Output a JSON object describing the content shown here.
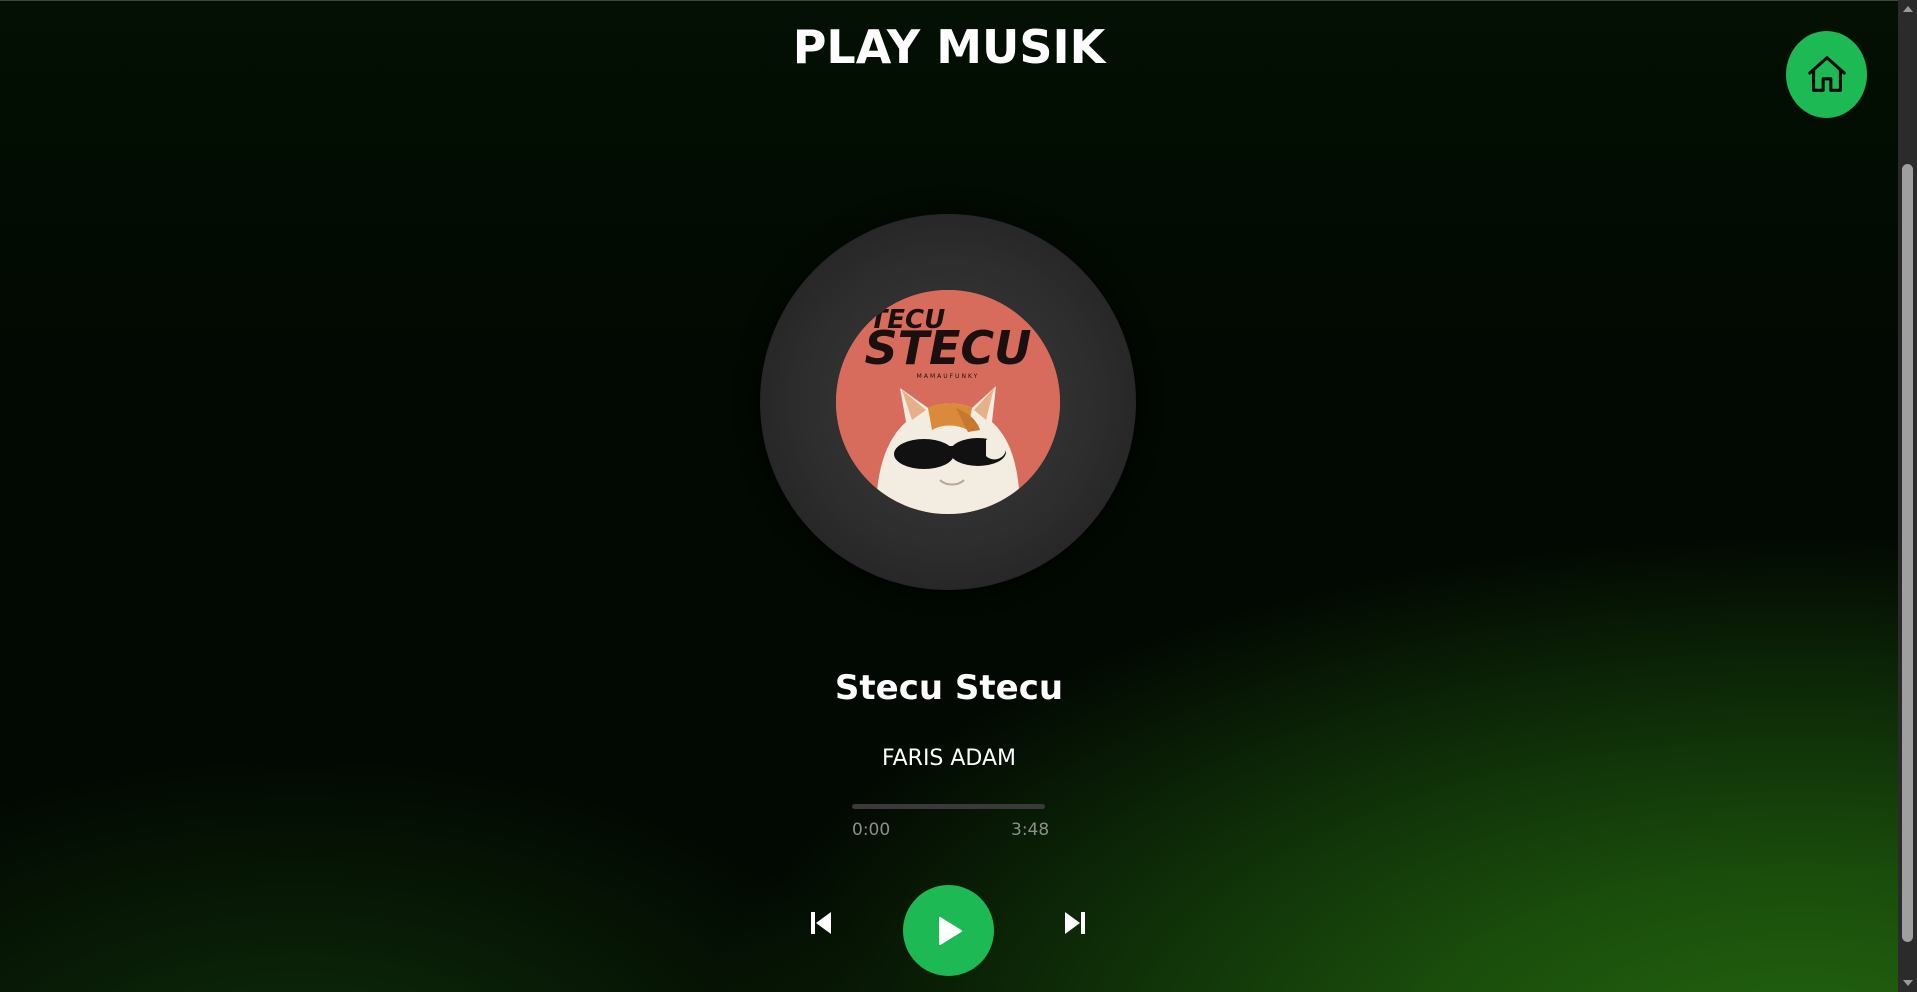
{
  "page": {
    "title": "PLAY MUSIK"
  },
  "home": {
    "icon": "home-icon",
    "color": "#1db954"
  },
  "album": {
    "cover_lines": [
      "STECU",
      "STECU",
      "MAMAUFUNKY"
    ],
    "cover_color": "#d86c5c"
  },
  "track": {
    "title": "Stecu Stecu",
    "artist": "FARIS ADAM",
    "current_time": "0:00",
    "total_time": "3:48",
    "progress": 0
  },
  "controls": {
    "prev_icon": "skip-previous-icon",
    "play_icon": "play-icon",
    "next_icon": "skip-next-icon",
    "accent": "#1db954"
  }
}
